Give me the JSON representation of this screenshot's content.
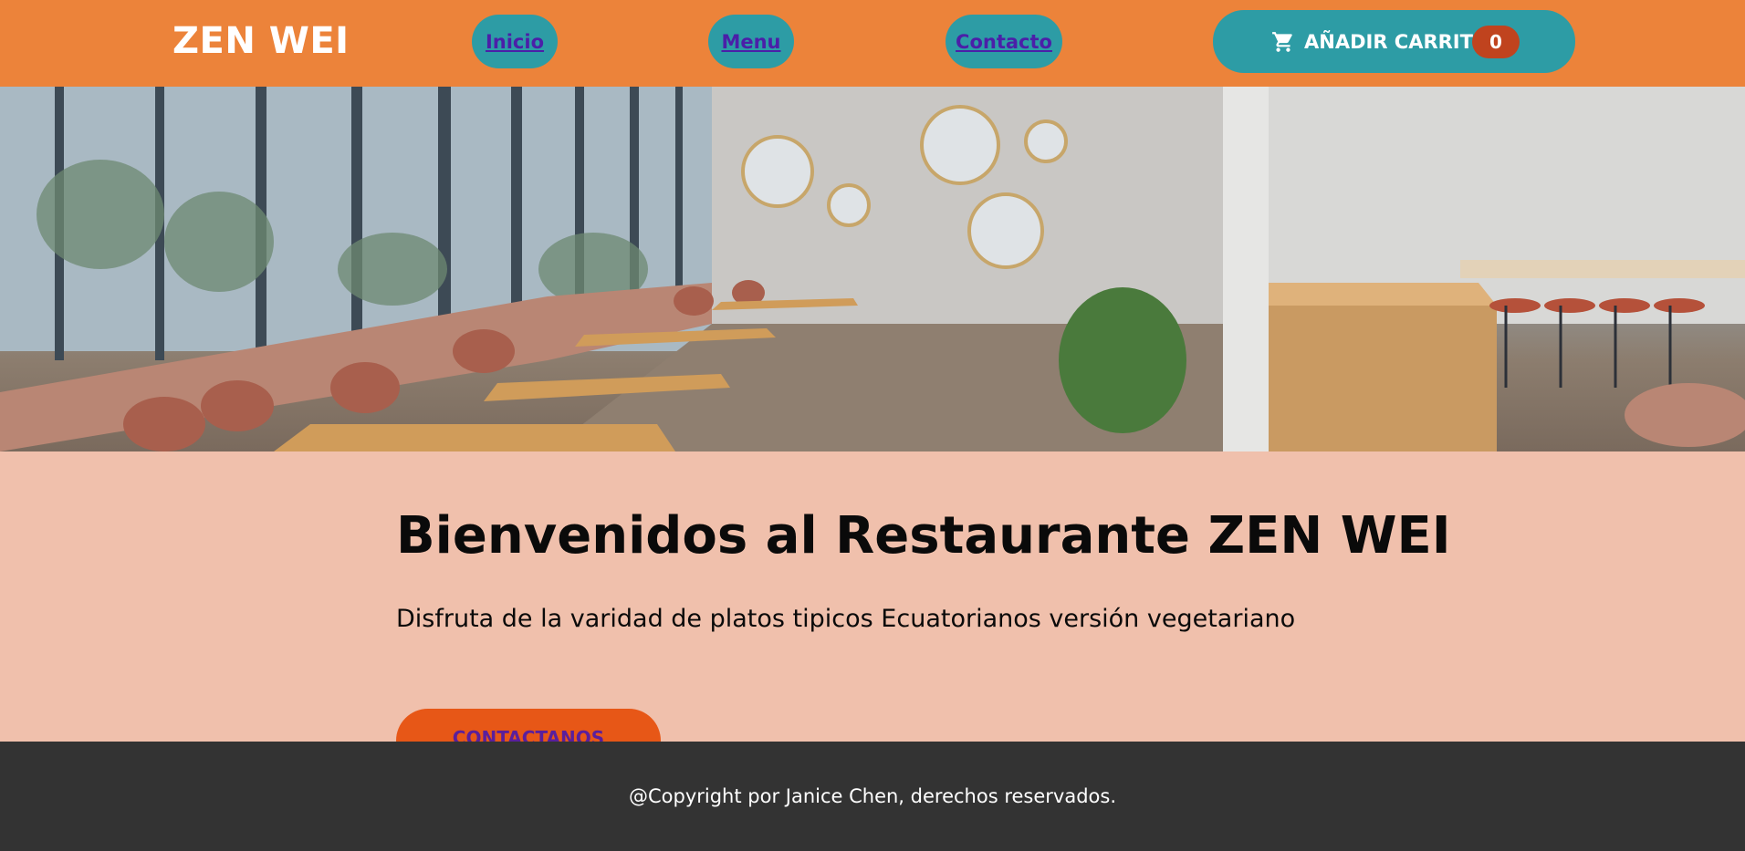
{
  "header": {
    "brand": "ZEN WEI",
    "nav": [
      {
        "label": "Inicio"
      },
      {
        "label": "Menu"
      },
      {
        "label": "Contacto"
      }
    ],
    "cart": {
      "label": "AÑADIR CARRITO",
      "count": "0",
      "icon": "cart-icon"
    }
  },
  "hero": {
    "image": "restaurant-interior"
  },
  "main": {
    "title": "Bienvenidos al Restaurante ZEN WEI",
    "subtitle": "Disfruta de la varidad de platos tipicos Ecuatorianos versión vegetariano",
    "cta_label": "CONTACTANOS"
  },
  "footer": {
    "copyright": "@Copyright por Janice Chen, derechos reservados."
  },
  "colors": {
    "header_bg": "#ec833a",
    "button_bg": "#2d9ca5",
    "cart_badge": "#c0431e",
    "content_bg": "#f0c0ac",
    "cta_bg": "#e75717",
    "footer_bg": "#333333"
  }
}
